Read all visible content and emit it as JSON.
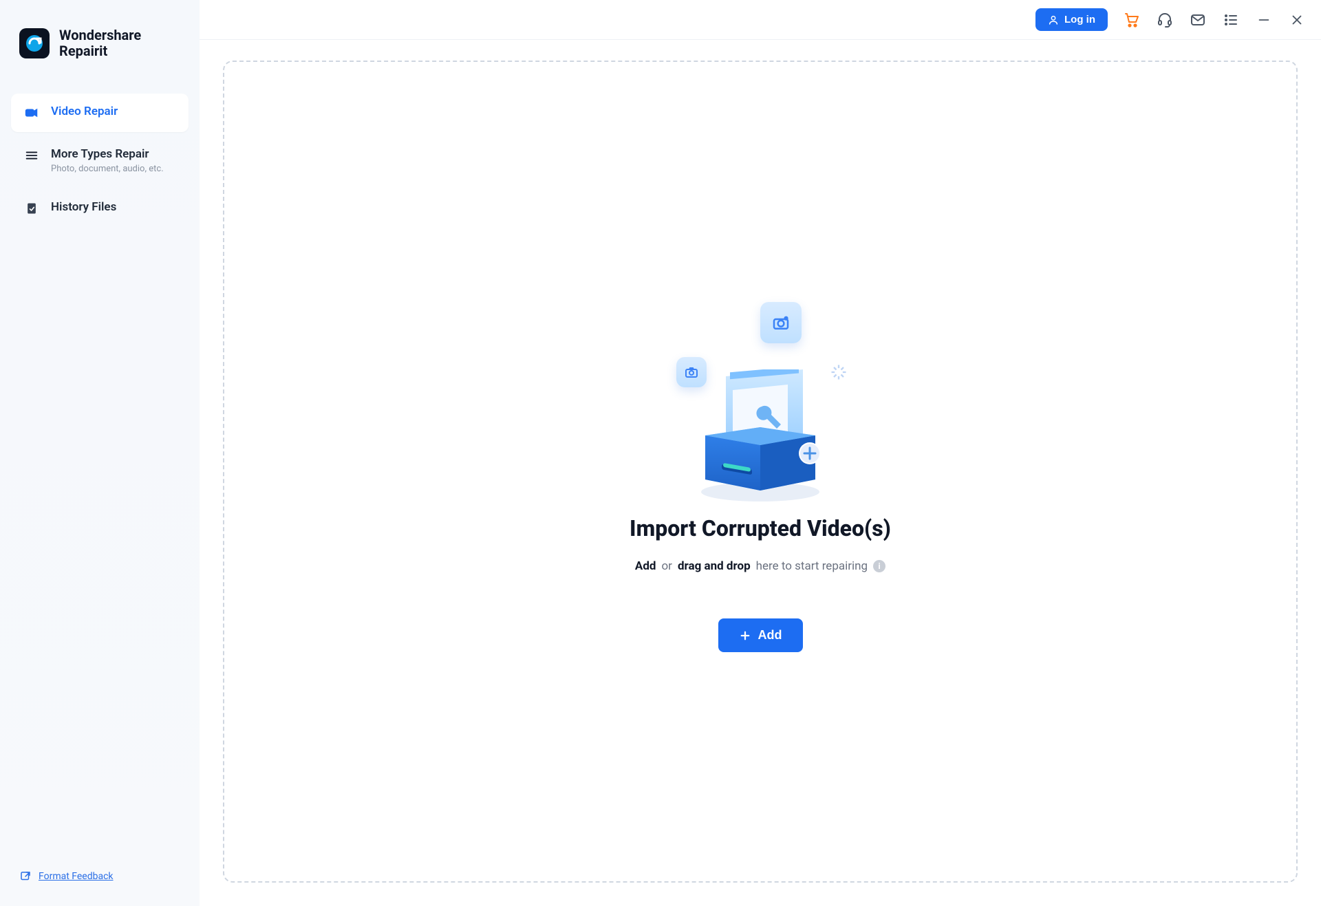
{
  "brand": {
    "line1": "Wondershare",
    "line2": "Repairit"
  },
  "sidebar": {
    "items": [
      {
        "label": "Video Repair"
      },
      {
        "label": "More Types Repair",
        "subtitle": "Photo, document, audio, etc."
      },
      {
        "label": "History Files"
      }
    ],
    "footer_link": "Format Feedback"
  },
  "titlebar": {
    "login_label": "Log in"
  },
  "main": {
    "headline": "Import Corrupted Video(s)",
    "hint_add": "Add",
    "hint_or": "or",
    "hint_dnd": "drag and drop",
    "hint_tail": "here to start repairing",
    "add_button": "Add"
  }
}
